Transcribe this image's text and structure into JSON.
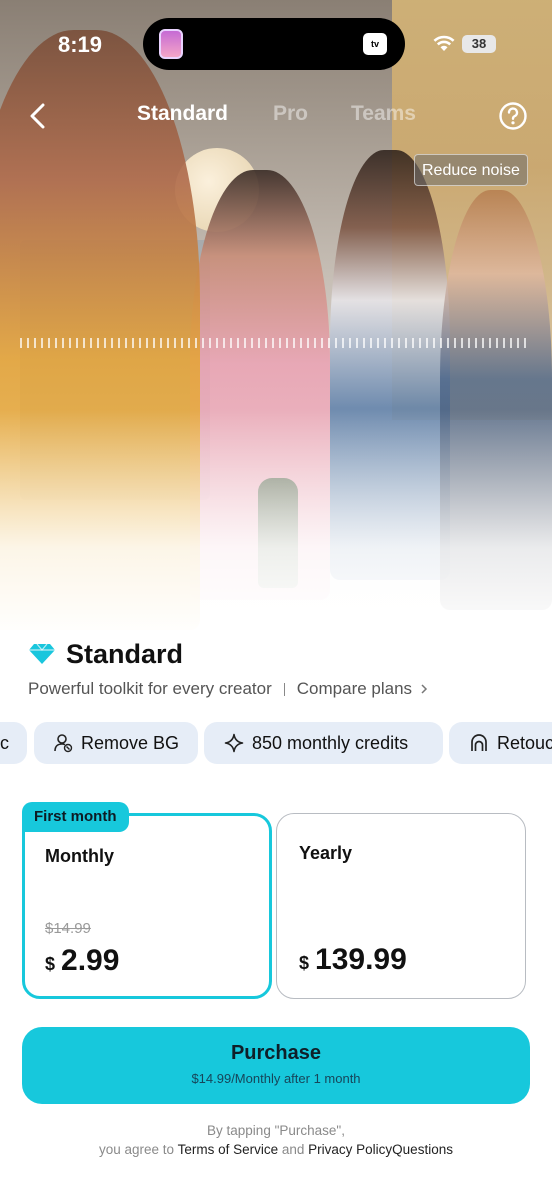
{
  "status_bar": {
    "time": "8:19",
    "battery": "38",
    "island_tv": "tv"
  },
  "nav": {
    "tabs": [
      {
        "label": "Standard",
        "active": true
      },
      {
        "label": "Pro",
        "active": false
      },
      {
        "label": "Teams",
        "active": false
      }
    ]
  },
  "hero": {
    "reduce_noise_label": "Reduce noise"
  },
  "plan": {
    "title": "Standard",
    "subtitle": "Powerful toolkit for every creator",
    "compare_label": "Compare plans"
  },
  "features": [
    {
      "label": "c",
      "icon": "partial-chip"
    },
    {
      "label": "Remove BG",
      "icon": "person-remove-icon"
    },
    {
      "label": "850 monthly credits",
      "icon": "sparkle-icon"
    },
    {
      "label": "Retouc",
      "icon": "retouch-icon"
    }
  ],
  "options": {
    "monthly": {
      "badge": "First month",
      "name": "Monthly",
      "old_price": "$14.99",
      "currency": "$",
      "price": "2.99",
      "selected": true
    },
    "yearly": {
      "name": "Yearly",
      "currency": "$",
      "price": "139.99",
      "selected": false
    }
  },
  "purchase": {
    "label": "Purchase",
    "sub": "$14.99/Monthly after 1 month"
  },
  "legal": {
    "line1": "By tapping \"Purchase\",",
    "prefix": "you agree to ",
    "terms": "Terms of Service",
    "and": " and ",
    "privacy": "Privacy Policy",
    "questions": "Questions"
  },
  "colors": {
    "accent": "#17c8dc",
    "chip_bg": "#e6edf7",
    "diamond": "#19c6dd"
  }
}
